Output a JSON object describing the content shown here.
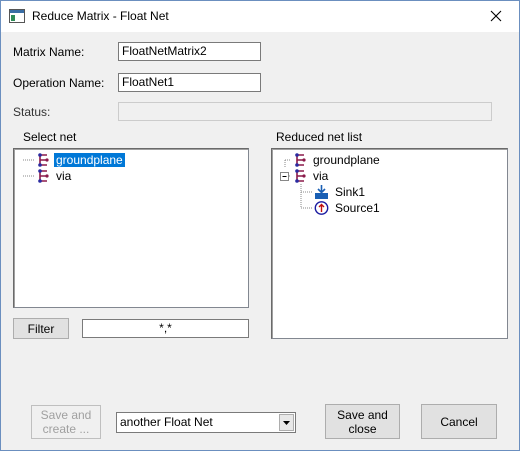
{
  "window": {
    "title": "Reduce Matrix - Float Net"
  },
  "form": {
    "matrix_name_label": "Matrix Name:",
    "matrix_name_value": "FloatNetMatrix2",
    "operation_name_label": "Operation Name:",
    "operation_name_value": "FloatNet1",
    "status_label": "Status:",
    "status_value": ""
  },
  "select_net": {
    "label": "Select net",
    "items": [
      {
        "label": "groundplane",
        "selected": true
      },
      {
        "label": "via",
        "selected": false
      }
    ],
    "filter_button": "Filter",
    "filter_value": "*,*"
  },
  "reduced_net": {
    "label": "Reduced net list",
    "items": [
      {
        "label": "groundplane"
      },
      {
        "label": "via",
        "expanded": true,
        "children": [
          {
            "label": "Sink1",
            "icon": "sink-icon"
          },
          {
            "label": "Source1",
            "icon": "source-icon"
          }
        ]
      }
    ]
  },
  "footer": {
    "save_create_label_1": "Save and",
    "save_create_label_2": "create ...",
    "mode_select_value": "another Float Net",
    "save_close_label_1": "Save and",
    "save_close_label_2": "close",
    "cancel_label": "Cancel"
  },
  "colors": {
    "selection": "#0078d7",
    "net_icon": "#8b1a4a",
    "net_dot": "#2a2aa0"
  }
}
